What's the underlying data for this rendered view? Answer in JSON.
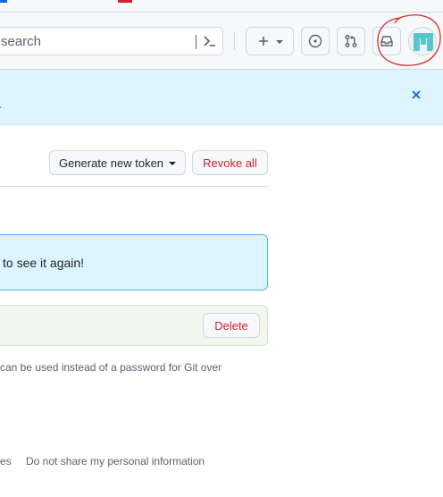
{
  "header": {
    "search_placeholder": "search",
    "plus_label": "+",
    "icons": [
      "command-palette-icon",
      "plus-icon",
      "chevron-down-icon",
      "issue-icon",
      "pull-request-icon",
      "inbox-icon",
      "avatar"
    ]
  },
  "flash": {
    "text_fragment": "."
  },
  "actions": {
    "generate_label": "Generate new token",
    "revoke_label": "Revoke all"
  },
  "notice": {
    "text": "to see it again!"
  },
  "token": {
    "delete_label": "Delete"
  },
  "help": {
    "text": "can be used instead of a password for Git over"
  },
  "footer": {
    "left_fragment": "es",
    "privacy_link": "Do not share my personal information"
  },
  "colors": {
    "accent_blue": "#0969da",
    "danger_red": "#cf222e",
    "flash_bg": "#ddf4ff",
    "success_bg": "#f0f8ee"
  }
}
